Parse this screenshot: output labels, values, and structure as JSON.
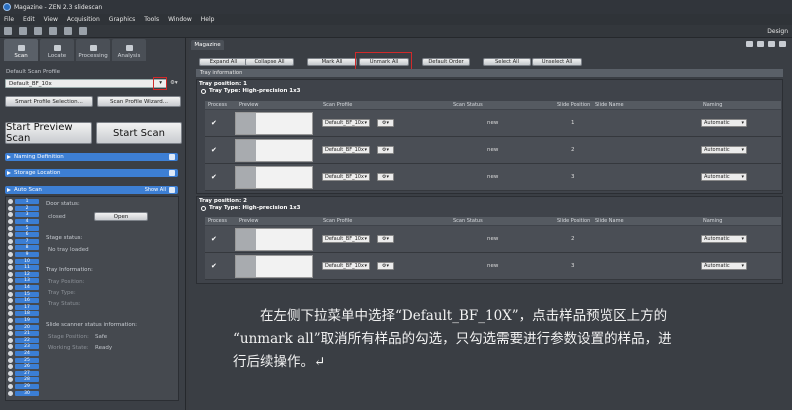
{
  "window": {
    "title": "Magazine - ZEN 2.3 slidescan",
    "design_label": "Design"
  },
  "menu": [
    "File",
    "Edit",
    "View",
    "Acquisition",
    "Graphics",
    "Tools",
    "Window",
    "Help"
  ],
  "left": {
    "tabs": [
      {
        "label": "Scan",
        "icon": "scan-icon",
        "active": true
      },
      {
        "label": "Locate",
        "icon": "locate-icon",
        "active": false
      },
      {
        "label": "Processing",
        "icon": "processing-icon",
        "active": false
      },
      {
        "label": "Analysis",
        "icon": "analysis-icon",
        "active": false
      }
    ],
    "profile_label": "Default Scan Profile",
    "profile_value": "Default_BF_10x",
    "smart_btn": "Smart Profile Selection...",
    "wizard_btn": "Scan Profile Wizard...",
    "start_preview": "Start Preview Scan",
    "start_scan": "Start Scan",
    "sections": [
      "Naming Definition",
      "Storage Location",
      "Auto Scan"
    ],
    "show_all": "Show All",
    "steps": [
      "1",
      "2",
      "3",
      "4",
      "5",
      "6",
      "7",
      "8",
      "9",
      "10",
      "11",
      "12",
      "13",
      "14",
      "15",
      "16",
      "17",
      "18",
      "19",
      "20",
      "21",
      "22",
      "23",
      "24",
      "25",
      "26",
      "27",
      "28",
      "29",
      "30"
    ],
    "door_status_label": "Door status:",
    "door_status_value": "closed",
    "open_btn": "Open",
    "stage_status_label": "Stage status:",
    "stage_status_value": "No tray loaded",
    "tray_info_label": "Tray Information:",
    "tray_position": "Tray Position:",
    "tray_type": "Tray Type:",
    "tray_status": "Tray Status:",
    "slide_scanner_label": "Slide scanner status information:",
    "stage_position_label": "Stage Position:",
    "stage_position_value": "Safe",
    "working_state_label": "Working State:",
    "working_state_value": "Ready"
  },
  "right": {
    "tab": "Magazine",
    "actions": [
      "Expand All",
      "Collapse All",
      "Mark All",
      "Unmark All",
      "Default Order",
      "Select All",
      "Unselect All"
    ],
    "tray_information": "Tray information",
    "columns": [
      "Process",
      "Preview",
      "Scan Profile",
      "Scan Status",
      "Slide Position",
      "Slide Name",
      "Naming"
    ],
    "trays": [
      {
        "position_text": "Tray position:  1",
        "type_text": "Tray Type:  High-precision 1x3",
        "rows": [
          {
            "check": "✔",
            "profile": "Default_BF_10x",
            "status": "new",
            "slot": "1",
            "naming": "Automatic"
          },
          {
            "check": "✔",
            "profile": "Default_BF_10x",
            "status": "new",
            "slot": "2",
            "naming": "Automatic"
          },
          {
            "check": "✔",
            "profile": "Default_BF_10x",
            "status": "new",
            "slot": "3",
            "naming": "Automatic"
          }
        ]
      },
      {
        "position_text": "Tray position:  2",
        "type_text": "Tray Type:  High-precision 1x3",
        "rows": [
          {
            "check": "✔",
            "profile": "Default_BF_10x",
            "status": "new",
            "slot": "2",
            "naming": "Automatic"
          },
          {
            "check": "✔",
            "profile": "Default_BF_10x",
            "status": "new",
            "slot": "3",
            "naming": "Automatic"
          }
        ]
      }
    ]
  },
  "caption": [
    "在左侧下拉菜单中选择“Default_BF_10X”，点击样品预览区上方的",
    "“unmark all”取消所有样品的勾选，只勾选需要进行参数设置的样品，进",
    "行后续操作。↵"
  ]
}
